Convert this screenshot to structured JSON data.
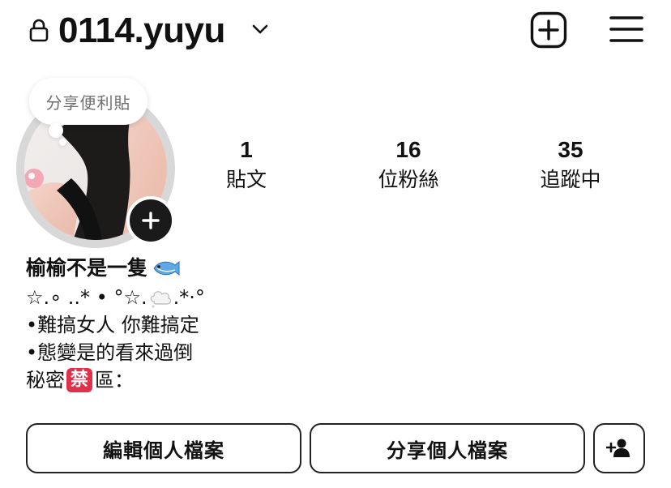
{
  "header": {
    "username": "0114.yuyu",
    "icons": {
      "lock": "lock-icon",
      "dropdown": "chevron-down-icon",
      "create": "add-square-icon",
      "menu": "hamburger-menu-icon"
    }
  },
  "note": {
    "text": "分享便利貼"
  },
  "profile": {
    "add_story_icon": "plus-icon"
  },
  "stats": {
    "posts": {
      "value": "1",
      "label": "貼文"
    },
    "followers": {
      "value": "16",
      "label": "位粉絲"
    },
    "following": {
      "value": "35",
      "label": "追蹤中"
    }
  },
  "bio": {
    "name": "榆榆不是一隻",
    "name_emoji": "fish-icon",
    "line1_a": "☆.∘ ..* • °☆.",
    "line1_emoji": "cloud-icon",
    "line1_b": ".*·°",
    "line2": "•難搞女人 你難搞定",
    "line3": "•態變是的看來過倒",
    "line4_a": "秘密",
    "line4_emoji": "禁",
    "line4_b": "區："
  },
  "actions": {
    "edit_profile": "編輯個人檔案",
    "share_profile": "分享個人檔案",
    "discover_people_icon": "add-person-icon"
  },
  "colors": {
    "text": "#111111",
    "note_text": "#707070",
    "forbidden_badge": "#e0304a",
    "ring": "#d8d8d8"
  }
}
